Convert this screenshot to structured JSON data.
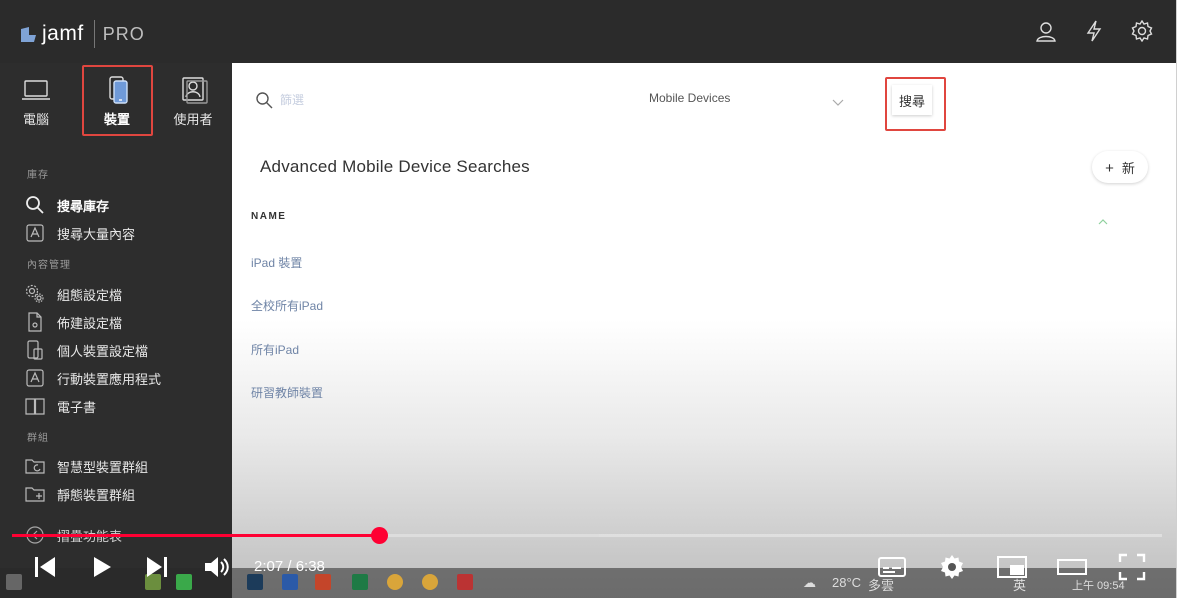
{
  "header": {
    "logo_text": "jamf",
    "logo_suffix": "PRO"
  },
  "categories": [
    {
      "label": "電腦",
      "active": false
    },
    {
      "label": "裝置",
      "active": true
    },
    {
      "label": "使用者",
      "active": false
    }
  ],
  "sidebar": {
    "sections": [
      {
        "title": "庫存"
      },
      {
        "title": "內容管理"
      },
      {
        "title": "群組"
      }
    ],
    "items": [
      {
        "label": "搜尋庫存",
        "icon": "search-icon",
        "active": true
      },
      {
        "label": "搜尋大量內容",
        "icon": "app-icon",
        "active": false
      },
      {
        "label": "組態設定檔",
        "icon": "gear-icon",
        "active": false
      },
      {
        "label": "佈建設定檔",
        "icon": "document-icon",
        "active": false
      },
      {
        "label": "個人裝置設定檔",
        "icon": "device-profile-icon",
        "active": false
      },
      {
        "label": "行動裝置應用程式",
        "icon": "app-store-icon",
        "active": false
      },
      {
        "label": "電子書",
        "icon": "book-icon",
        "active": false
      },
      {
        "label": "智慧型裝置群組",
        "icon": "smart-group-icon",
        "active": false
      },
      {
        "label": "靜態裝置群組",
        "icon": "static-group-icon",
        "active": false
      },
      {
        "label": "摺疊功能表",
        "icon": "collapse-icon",
        "active": false
      }
    ]
  },
  "search": {
    "placeholder": "篩選",
    "type_selected": "Mobile Devices",
    "button_label": "搜尋"
  },
  "main": {
    "title": "Advanced Mobile Device Searches",
    "new_button_label": "新",
    "column_header": "NAME",
    "rows": [
      "iPad 裝置",
      "全校所有iPad",
      "所有iPad",
      "研習教師裝置"
    ]
  },
  "video": {
    "current_time": "2:07",
    "duration": "6:38",
    "time_display": "2:07 / 6:38",
    "played_fraction": 0.319,
    "buffered_fraction": 0.51
  },
  "taskbar": {
    "temperature": "28°C",
    "weather": "多雲",
    "ime": "英",
    "clock": "上午 09:54"
  },
  "colors": {
    "accent_red": "#e0463f",
    "progress_red": "#ff0033",
    "link_blue": "#6f84a6",
    "sidebar_bg": "#2d2d2d"
  }
}
